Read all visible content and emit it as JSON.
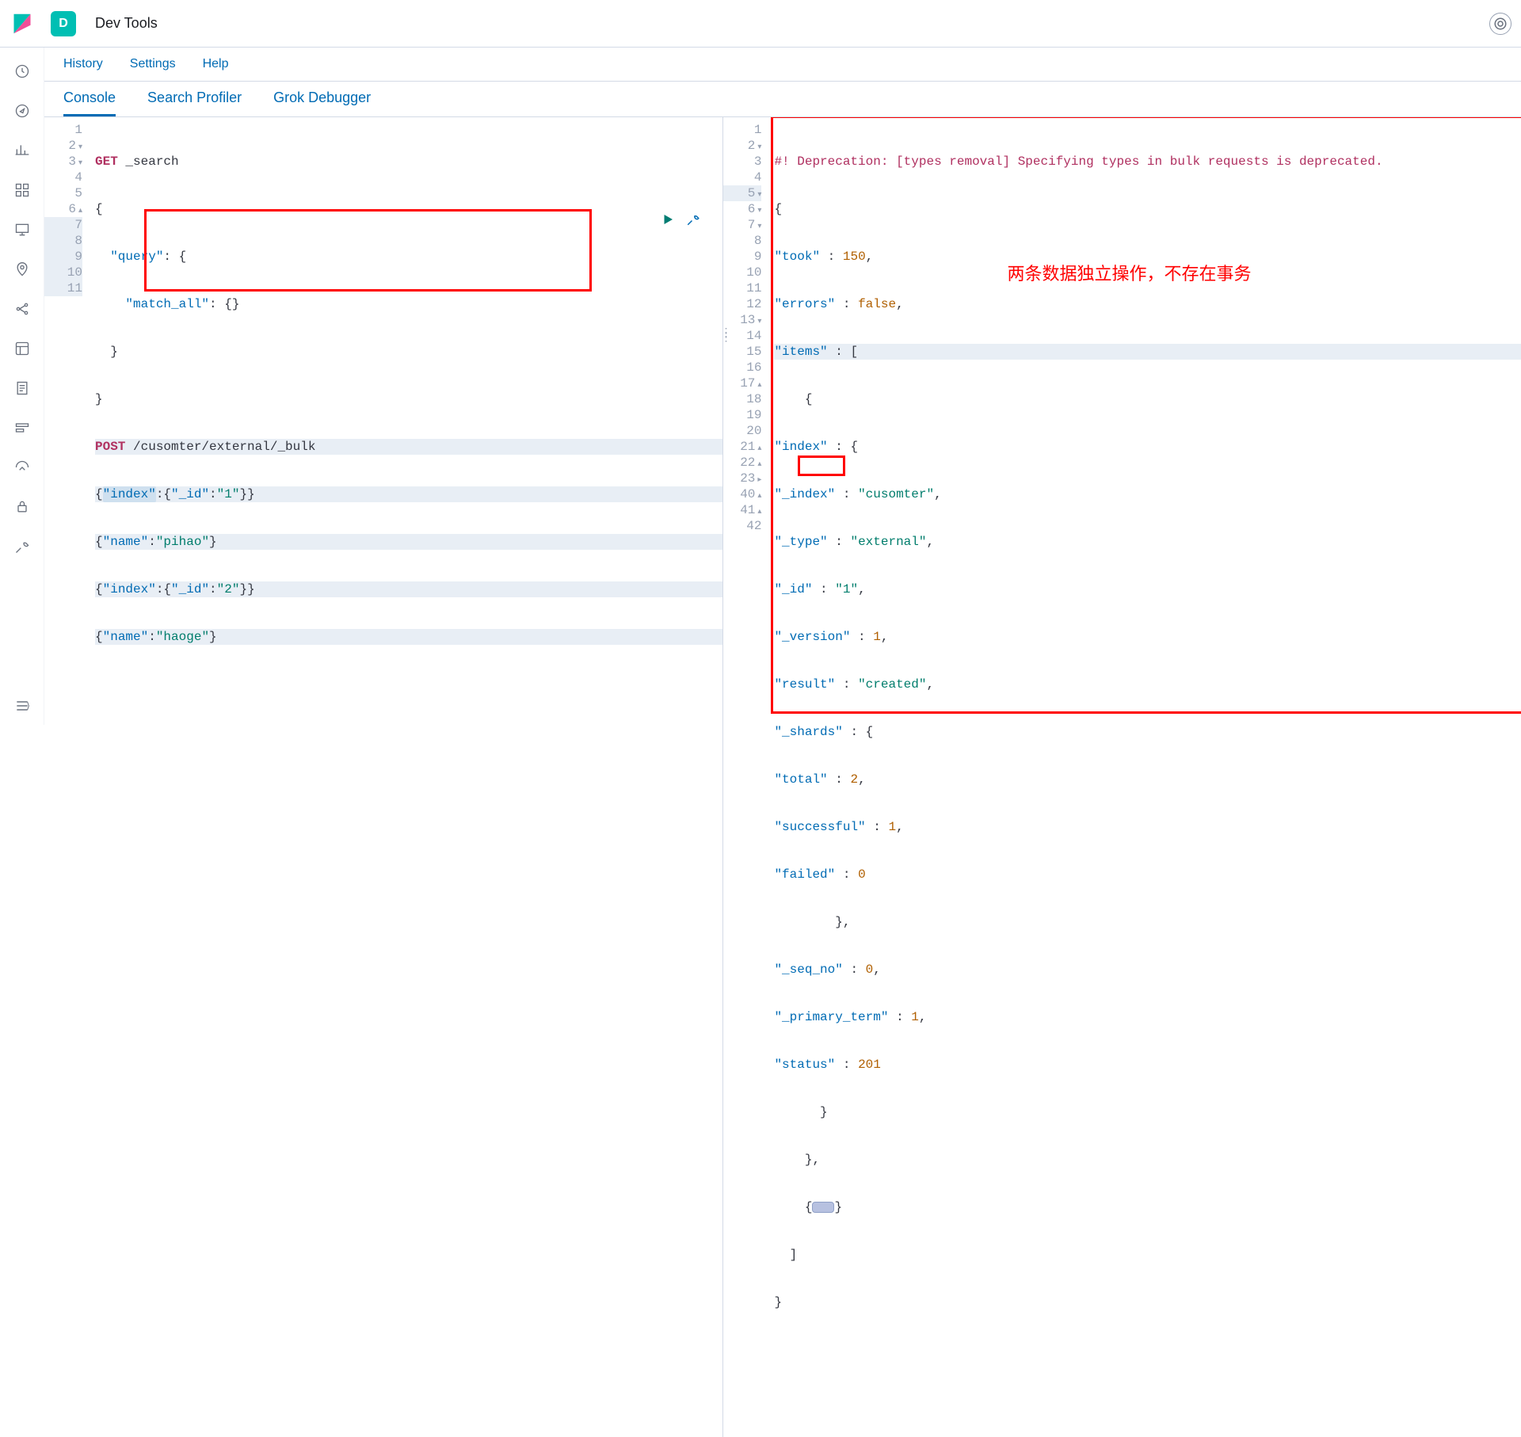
{
  "header": {
    "app_badge": "D",
    "app_title": "Dev Tools"
  },
  "submenu": {
    "history": "History",
    "settings": "Settings",
    "help": "Help"
  },
  "tabs": {
    "console": "Console",
    "search_profiler": "Search Profiler",
    "grok_debugger": "Grok Debugger"
  },
  "annotation": {
    "red_text": "两条数据独立操作，不存在事务"
  },
  "left_editor": {
    "lines": [
      "1",
      "2",
      "3",
      "4",
      "5",
      "6",
      "7",
      "8",
      "9",
      "10",
      "11"
    ],
    "l1_method": "GET",
    "l1_path": " _search",
    "l2": "{",
    "l3_pre": "  ",
    "l3_key": "\"query\"",
    "l3_post": ": {",
    "l4_pre": "    ",
    "l4_key": "\"match_all\"",
    "l4_post": ": {}",
    "l5": "  }",
    "l6": "}",
    "l7_method": "POST",
    "l7_path": " /cusomter/external/_bulk",
    "l8_a": "{",
    "l8_key1": "\"index\"",
    "l8_b": ":{",
    "l8_key2": "\"_id\"",
    "l8_c": ":",
    "l8_val": "\"1\"",
    "l8_d": "}}",
    "l9_a": "{",
    "l9_key": "\"name\"",
    "l9_b": ":",
    "l9_val": "\"pihao\"",
    "l9_c": "}",
    "l10_a": "{",
    "l10_key1": "\"index\"",
    "l10_b": ":{",
    "l10_key2": "\"_id\"",
    "l10_c": ":",
    "l10_val": "\"2\"",
    "l10_d": "}}",
    "l11_a": "{",
    "l11_key": "\"name\"",
    "l11_b": ":",
    "l11_val": "\"haoge\"",
    "l11_c": "}"
  },
  "right_editor": {
    "lines": [
      "1",
      "2",
      "3",
      "4",
      "5",
      "6",
      "7",
      "8",
      "9",
      "10",
      "11",
      "12",
      "13",
      "14",
      "15",
      "16",
      "17",
      "18",
      "19",
      "20",
      "21",
      "22",
      "23",
      "40",
      "41",
      "42"
    ],
    "l1": "#! Deprecation: [types removal] Specifying types in bulk requests is deprecated.",
    "l2": "{",
    "l3_k": "\"took\"",
    "l3_m": " : ",
    "l3_v": "150",
    "l3_e": ",",
    "l4_k": "\"errors\"",
    "l4_m": " : ",
    "l4_v": "false",
    "l4_e": ",",
    "l5_k": "\"items\"",
    "l5_m": " : [",
    "l6": "    {",
    "l7_k": "\"index\"",
    "l7_m": " : {",
    "l8_k": "\"_index\"",
    "l8_m": " : ",
    "l8_v": "\"cusomter\"",
    "l8_e": ",",
    "l9_k": "\"_type\"",
    "l9_m": " : ",
    "l9_v": "\"external\"",
    "l9_e": ",",
    "l10_k": "\"_id\"",
    "l10_m": " : ",
    "l10_v": "\"1\"",
    "l10_e": ",",
    "l11_k": "\"_version\"",
    "l11_m": " : ",
    "l11_v": "1",
    "l11_e": ",",
    "l12_k": "\"result\"",
    "l12_m": " : ",
    "l12_v": "\"created\"",
    "l12_e": ",",
    "l13_k": "\"_shards\"",
    "l13_m": " : {",
    "l14_k": "\"total\"",
    "l14_m": " : ",
    "l14_v": "2",
    "l14_e": ",",
    "l15_k": "\"successful\"",
    "l15_m": " : ",
    "l15_v": "1",
    "l15_e": ",",
    "l16_k": "\"failed\"",
    "l16_m": " : ",
    "l16_v": "0",
    "l17": "        },",
    "l18_k": "\"_seq_no\"",
    "l18_m": " : ",
    "l18_v": "0",
    "l18_e": ",",
    "l19_k": "\"_primary_term\"",
    "l19_m": " : ",
    "l19_v": "1",
    "l19_e": ",",
    "l20_k": "\"status\"",
    "l20_m": " : ",
    "l20_v": "201",
    "l21": "      }",
    "l22": "    },",
    "l23_a": "    {",
    "l23_b": "}",
    "l40": "  ]",
    "l41": "}",
    "l42": ""
  }
}
